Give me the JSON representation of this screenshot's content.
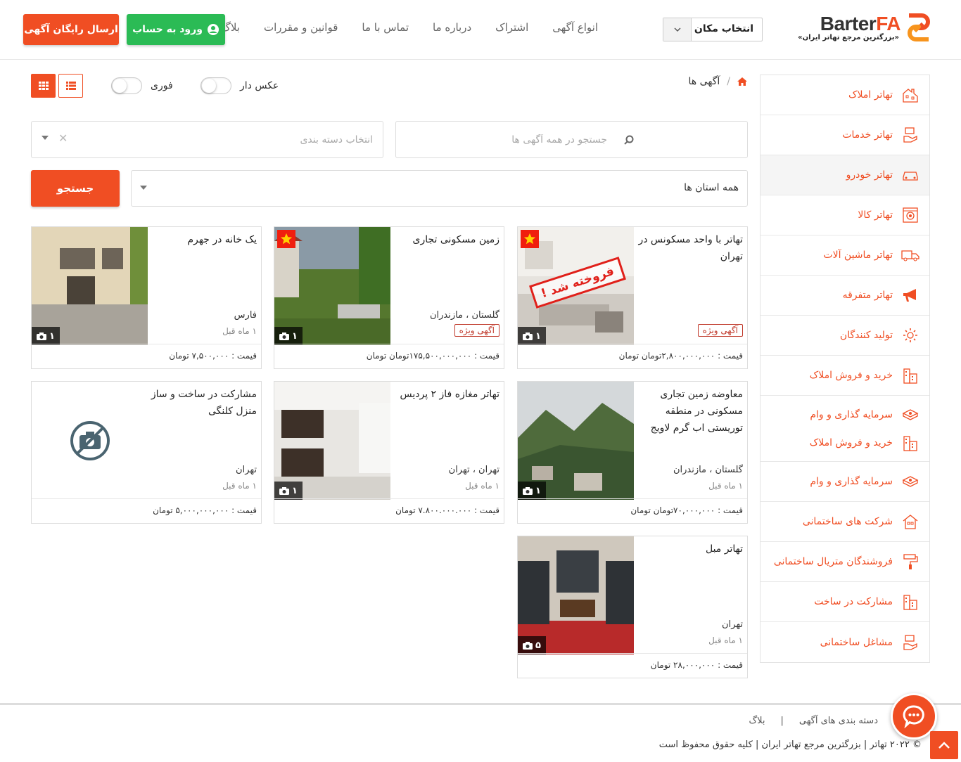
{
  "brand": {
    "name_part1": "Barter",
    "name_part2": "FA",
    "tagline": "«بزرگترین مرجع تهاتر ایران»",
    "accent": "#f04e23",
    "green": "#2bbb55"
  },
  "header": {
    "location_label": "انتخاب مکان",
    "nav": [
      "انواع آگهی",
      "اشتراک",
      "درباره ما",
      "تماس با ما",
      "قوانین و مقررات",
      "بلاگ"
    ],
    "login_label": "ورود به حساب",
    "post_label": "ارسال رایگان آگهی"
  },
  "sidebar": {
    "items": [
      {
        "label": "تهاتر املاک",
        "icon": "building-icon"
      },
      {
        "label": "تهاتر خدمات",
        "icon": "hand-service-icon"
      },
      {
        "label": "تهاتر خودرو",
        "icon": "car-icon",
        "active": true
      },
      {
        "label": "تهاتر کالا",
        "icon": "washing-machine-icon"
      },
      {
        "label": "تهاتر ماشین آلات",
        "icon": "truck-icon"
      },
      {
        "label": "تهاتر متفرقه",
        "icon": "megaphone-icon"
      },
      {
        "label": "تولید کنندگان",
        "icon": "gear-icon"
      },
      {
        "label": "خرید و فروش املاک",
        "icon": "city-icon"
      },
      {
        "label": "سرمایه گذاری و وام",
        "label2": "خرید و فروش املاک",
        "icon": "money-icon",
        "icon2": "city-icon"
      },
      {
        "label": "سرمایه گذاری و وام",
        "icon": "money-icon"
      },
      {
        "label": "شرکت های ساختمانی",
        "icon": "house-icon"
      },
      {
        "label": "فروشندگان متریال ساختمانی",
        "icon": "paint-roller-icon"
      },
      {
        "label": "مشارکت در ساخت",
        "icon": "city-icon"
      },
      {
        "label": "مشاغل ساختمانی",
        "icon": "hand-service-icon"
      }
    ]
  },
  "breadcrumb": {
    "current": "آگهی ها"
  },
  "filters": {
    "with_photo": "عکس دار",
    "urgent": "فوری",
    "search_placeholder": "جستجو در همه آگهی ها",
    "category_placeholder": "انتخاب دسته بندی",
    "province": "همه استان ها",
    "search_button": "جستجو"
  },
  "listings": [
    {
      "title": "تهاتر با واحد مسکونس در تهران",
      "location": "",
      "time": "",
      "badge": "آگهی ویژه",
      "price": "قیمت : ۲,۸۰۰,۰۰۰,۰۰۰تومان تومان",
      "photos": "۱",
      "featured": true,
      "sold": "فروخته شد !",
      "img": "room"
    },
    {
      "title": "زمین مسکونی تجاری",
      "location": "گلستان ، مازندران",
      "time": "",
      "badge": "آگهی ویژه",
      "price": "قیمت : ۱۷۵,۵۰۰,۰۰۰,۰۰۰تومان تومان",
      "photos": "۱",
      "featured": true,
      "sold": "",
      "img": "land"
    },
    {
      "title": "یک خانه در جهرم",
      "location": "فارس",
      "time": "۱ ماه قبل",
      "badge": "",
      "price": "قیمت : ۷,۵۰۰,۰۰۰ تومان",
      "photos": "۱",
      "featured": false,
      "sold": "",
      "img": "house"
    },
    {
      "title": "معاوضه زمین تجاری مسکونی در منطقه توریستی اب گرم لاویج",
      "location": "گلستان ، مازندران",
      "time": "۱ ماه قبل",
      "badge": "",
      "price": "قیمت : ۷۰,۰۰۰,۰۰۰تومان تومان",
      "photos": "۱",
      "featured": false,
      "sold": "",
      "img": "mountain"
    },
    {
      "title": "تهاتر مغازه فاز ۲ پردیس",
      "location": "تهران ، تهران",
      "time": "۱ ماه قبل",
      "badge": "",
      "price": "قیمت : ۷.۸۰۰.۰۰۰.۰۰۰ تومان",
      "photos": "۱",
      "featured": false,
      "sold": "",
      "img": "kitchen"
    },
    {
      "title": "مشارکت در ساخت و ساز منزل کلنگی",
      "location": "تهران",
      "time": "۱ ماه قبل",
      "badge": "",
      "price": "قیمت : ۵,۰۰۰,۰۰۰,۰۰۰ تومان",
      "photos": "",
      "featured": false,
      "sold": "",
      "img": "none"
    },
    {
      "title": "تهاتر مبل",
      "location": "تهران",
      "time": "۱ ماه قبل",
      "badge": "",
      "price": "قیمت : ۲۸,۰۰۰,۰۰۰ تومان",
      "photos": "۵",
      "featured": false,
      "sold": "",
      "img": "sofa"
    }
  ],
  "footer": {
    "links": [
      "دسته بندی های آگهی",
      "|",
      "بلاگ"
    ],
    "copyright": "© ۲۰۲۲ تهاتر | بزرگترین مرجع تهاتر ایران | کلیه حقوق محفوظ است"
  }
}
